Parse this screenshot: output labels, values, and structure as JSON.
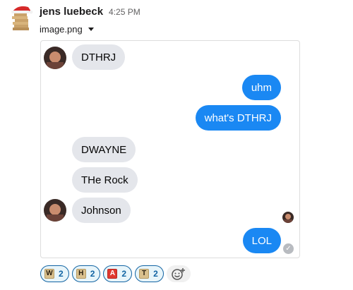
{
  "message": {
    "sender": "jens luebeck",
    "time": "4:25 PM",
    "file_name": "image.png"
  },
  "chat": {
    "bubbles": [
      {
        "text": "DTHRJ",
        "side": "in"
      },
      {
        "text": "uhm",
        "side": "out"
      },
      {
        "text": "what's DTHRJ",
        "side": "out"
      },
      {
        "text": "DWAYNE",
        "side": "in"
      },
      {
        "text": "THe Rock",
        "side": "in"
      },
      {
        "text": "Johnson",
        "side": "in"
      },
      {
        "text": "LOL",
        "side": "out"
      }
    ]
  },
  "reactions": [
    {
      "letter": "W",
      "count": "2",
      "style": "tan"
    },
    {
      "letter": "H",
      "count": "2",
      "style": "tan"
    },
    {
      "letter": "A",
      "count": "2",
      "style": "red"
    },
    {
      "letter": "T",
      "count": "2",
      "style": "tan"
    }
  ],
  "icons": {
    "avatar": "jenga-tower-santa-hat",
    "file_menu": "caret-down-icon",
    "seen": "check-circle-icon",
    "add_reaction": "add-reaction-icon"
  },
  "colors": {
    "incoming_bubble": "#e4e6eb",
    "outgoing_bubble": "#1a88f3",
    "reaction_border": "#1264a3"
  }
}
